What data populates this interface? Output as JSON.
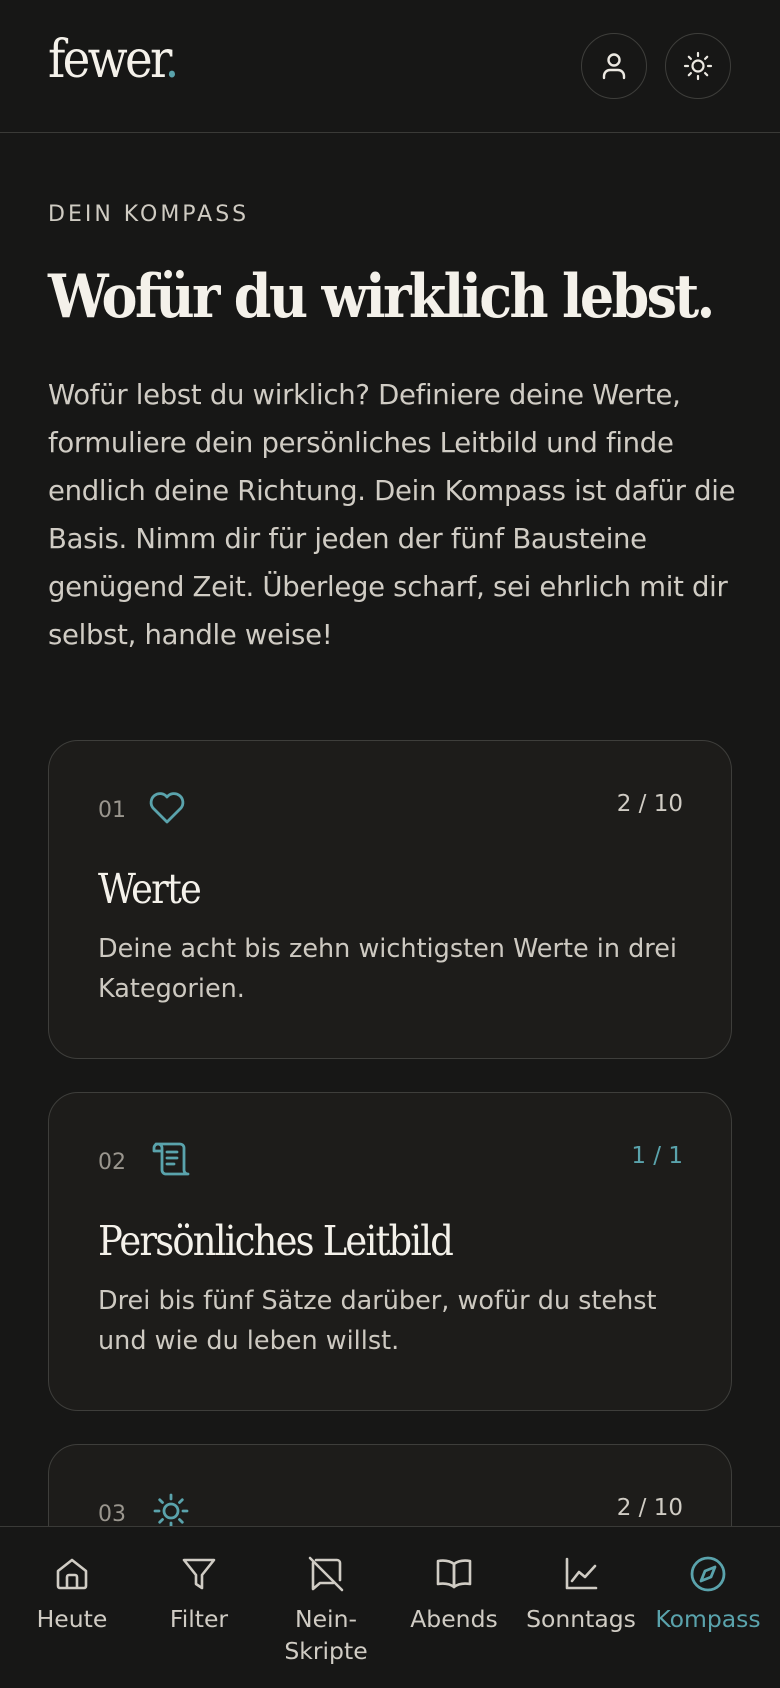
{
  "app": {
    "logo_text": "fewer",
    "logo_dot": "."
  },
  "header": {
    "profile_icon": "user-icon",
    "theme_icon": "sun-icon"
  },
  "intro": {
    "kicker": "DEIN KOMPASS",
    "title": "Wofür du wirklich lebst.",
    "body": "Wofür lebst du wirklich? Definiere deine Werte, formuliere dein persönliches Leitbild und finde endlich deine Richtung. Dein Kompass ist dafür die Basis. Nimm dir für jeden der fünf Bausteine genügend Zeit. Überlege scharf, sei ehrlich mit dir selbst, handle weise!"
  },
  "cards": [
    {
      "num": "01",
      "icon": "heart-icon",
      "progress": "2 / 10",
      "title": "Werte",
      "desc": "Deine acht bis zehn wichtigsten Werte in drei Kategorien."
    },
    {
      "num": "02",
      "icon": "scroll-icon",
      "progress": "1 / 1",
      "title": "Persönliches Leitbild",
      "desc": "Drei bis fünf Sätze darüber, wofür du stehst und wie du leben willst."
    },
    {
      "num": "03",
      "icon": "sun-icon",
      "progress": "2 / 10"
    }
  ],
  "nav": [
    {
      "label": "Heute",
      "icon": "home-icon"
    },
    {
      "label": "Filter",
      "icon": "filter-icon"
    },
    {
      "label": "Nein-\nSkripte",
      "icon": "message-off-icon"
    },
    {
      "label": "Abends",
      "icon": "book-open-icon"
    },
    {
      "label": "Sonntags",
      "icon": "chart-line-icon"
    },
    {
      "label": "Kompass",
      "icon": "compass-icon",
      "active": true
    }
  ],
  "colors": {
    "accent": "#5aa3ac",
    "background": "#171716",
    "card": "#1d1c1a",
    "text": "#e9e6df"
  }
}
